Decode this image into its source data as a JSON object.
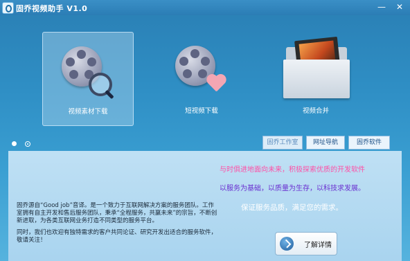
{
  "window": {
    "title": "固乔视频助手 V1.0",
    "minimize": "—",
    "close": "✕"
  },
  "tiles": [
    {
      "label": "视频素材下载",
      "icon": "film-reel-search-icon",
      "active": true
    },
    {
      "label": "短视频下载",
      "icon": "film-reel-heart-icon",
      "active": false
    },
    {
      "label": "视频合并",
      "icon": "folder-film-icon",
      "active": false
    }
  ],
  "tabs": [
    "固乔工作室",
    "网址导航",
    "固乔软件"
  ],
  "panel": {
    "intro": "固乔源自“Good job”音译。是一个致力于互联网解决方案的服务团队。工作室拥有自主开发和售后服务团队，秉承“全程服务，共赢未来”的宗旨，不断创新进取，为各类互联网业务打造不同类型的服务平台。",
    "welcome": "同时，我们也欢迎有独特需求的客户共同论证、研究开发出适合的服务软件，敬请关注！",
    "slogan1": "与时俱进地面向未来，积极探索优质的开发软件",
    "slogan2": "以服务为基础，以质量为生存，以科技求发展。",
    "slogan3": "保证服务品质，满足您的需求。",
    "detail_button": "了解详情"
  },
  "colors": {
    "bg": "#2f8fc5",
    "slogan_pink": "#ff4fa6",
    "slogan_purple": "#6a2fd0"
  }
}
